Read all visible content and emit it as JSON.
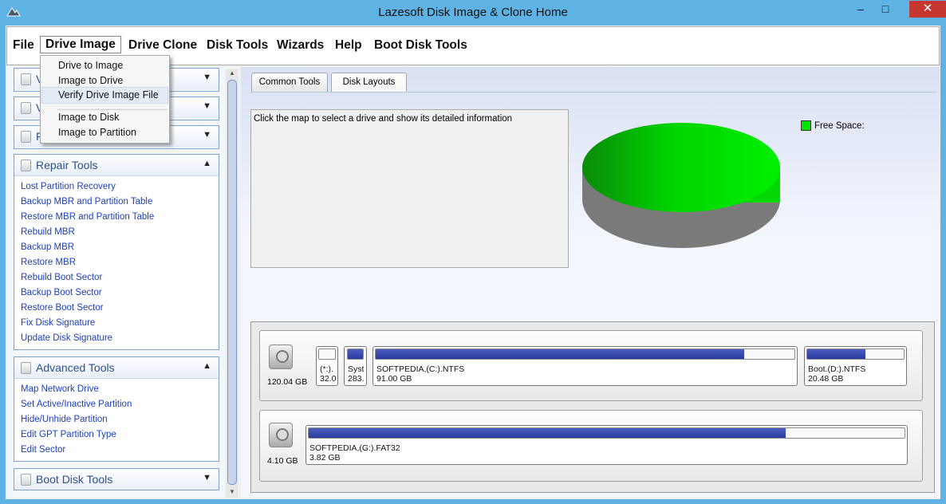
{
  "window": {
    "title": "Lazesoft Disk Image & Clone Home",
    "minimize_glyph": "–",
    "maximize_glyph": "□",
    "close_glyph": "✕",
    "app_icon": "mountain-icon"
  },
  "menu": {
    "items": [
      "File",
      "Drive Image",
      "Drive Clone",
      "Disk Tools",
      "Wizards",
      "Help",
      "Boot Disk Tools"
    ]
  },
  "dropdown": {
    "items": [
      "Drive to Image",
      "Image to Drive",
      "Verify Drive Image File",
      "Image to Disk",
      "Image to Partition"
    ]
  },
  "sidebar": {
    "collapsed_fragments": [
      "V",
      "V",
      "F"
    ],
    "repair": {
      "title": "Repair Tools",
      "links": [
        "Lost Partition Recovery",
        "Backup MBR and Partition Table",
        "Restore MBR and Partition Table",
        "Rebuild MBR",
        "Backup MBR",
        "Restore MBR",
        "Rebuild Boot Sector",
        "Backup Boot Sector",
        "Restore Boot Sector",
        "Fix Disk Signature",
        "Update Disk Signature"
      ]
    },
    "advanced": {
      "title": "Advanced Tools",
      "links": [
        "Map Network Drive",
        "Set Active/Inactive Partition",
        "Hide/Unhide Partition",
        "Edit GPT Partition Type",
        "Edit Sector"
      ]
    },
    "boot": {
      "title": "Boot Disk Tools"
    }
  },
  "tabs": [
    "Common Tools",
    "Disk Layouts"
  ],
  "info": {
    "text": "Click the map to select a drive and show its detailed information"
  },
  "legend": {
    "label": "Free Space:",
    "color": "#00e400"
  },
  "disks": [
    {
      "size": "120.04 GB",
      "partitions": [
        {
          "line1": "(*:).",
          "line2": "32.0",
          "fill": 0.0
        },
        {
          "line1": "Syst",
          "line2": "283.",
          "fill": 1.0
        },
        {
          "line1": "SOFTPEDIA,(C:).NTFS",
          "line2": "91.00 GB",
          "fill": 0.88
        },
        {
          "line1": "Boot.(D:).NTFS",
          "line2": "20.48 GB",
          "fill": 0.6
        }
      ]
    },
    {
      "size": "4.10 GB",
      "partitions": [
        {
          "line1": "SOFTPEDIA,(G:).FAT32",
          "line2": "3.82 GB",
          "fill": 0.8
        }
      ]
    }
  ],
  "colors": {
    "titlebar": "#5fb3e4",
    "close": "#c7372f",
    "link": "#1c3fb8",
    "partition_fill": "#2a3a9e",
    "pie_top": "#00e400",
    "pie_side": "#7a7a7a"
  }
}
